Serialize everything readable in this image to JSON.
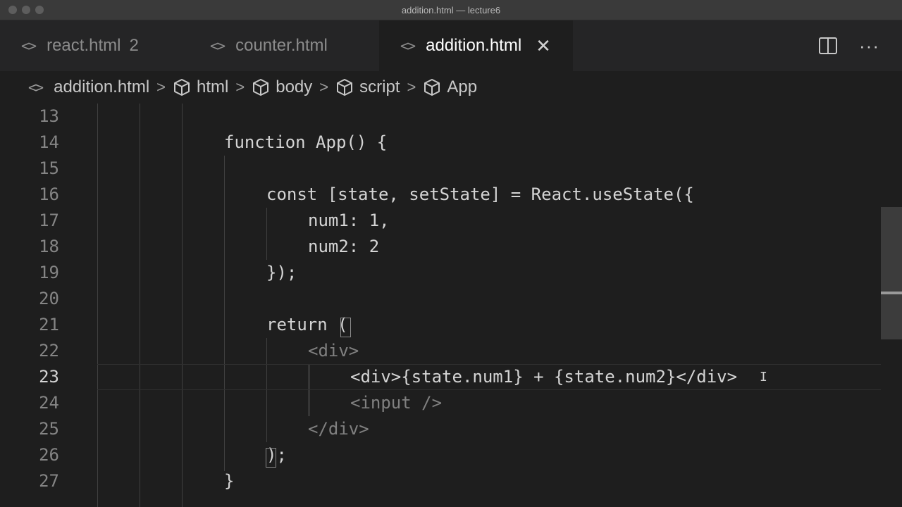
{
  "window": {
    "title": "addition.html — lecture6"
  },
  "tabs": [
    {
      "label": "react.html",
      "badge": "2",
      "active": false
    },
    {
      "label": "counter.html",
      "active": false
    },
    {
      "label": "addition.html",
      "active": true,
      "close": "✕"
    }
  ],
  "tab_actions": {
    "more": "···"
  },
  "breadcrumb": [
    {
      "label": "addition.html",
      "icon": "code-file-icon"
    },
    {
      "label": "html",
      "icon": "symbol-cube-icon"
    },
    {
      "label": "body",
      "icon": "symbol-cube-icon"
    },
    {
      "label": "script",
      "icon": "symbol-cube-icon"
    },
    {
      "label": "App",
      "icon": "symbol-cube-icon"
    }
  ],
  "editor": {
    "current_line": "23",
    "lines": [
      {
        "n": "13",
        "text": ""
      },
      {
        "n": "14",
        "text": "function App() {"
      },
      {
        "n": "15",
        "text": ""
      },
      {
        "n": "16",
        "text": "const [state, setState] = React.useState({"
      },
      {
        "n": "17",
        "text": "num1: 1,"
      },
      {
        "n": "18",
        "text": "num2: 2"
      },
      {
        "n": "19",
        "text": "});"
      },
      {
        "n": "20",
        "text": ""
      },
      {
        "n": "21",
        "text": "return ("
      },
      {
        "n": "22",
        "text": "<div>"
      },
      {
        "n": "23",
        "text": "<div>{state.num1} + {state.num2}</div>"
      },
      {
        "n": "24",
        "text": "<input />"
      },
      {
        "n": "25",
        "text": "</div>"
      },
      {
        "n": "26",
        "text": ");"
      },
      {
        "n": "27",
        "text": "}"
      }
    ]
  }
}
